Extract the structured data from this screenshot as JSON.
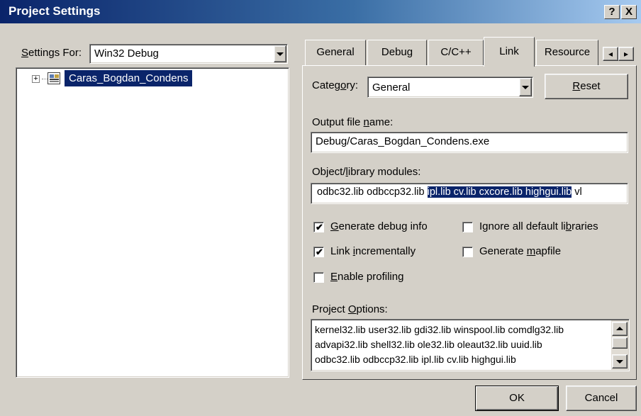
{
  "window": {
    "title": "Project Settings",
    "help_button": "?",
    "close_button": "X"
  },
  "settings_for": {
    "label_prefix": "S",
    "label_rest": "ettings For:",
    "value": "Win32 Debug",
    "tree": [
      {
        "label": "Caras_Bogdan_Condens",
        "expand": "+"
      }
    ]
  },
  "tabs": [
    {
      "label": "General"
    },
    {
      "label": "Debug"
    },
    {
      "label": "C/C++"
    },
    {
      "label": "Link"
    },
    {
      "label": "Resource"
    }
  ],
  "tab_scroll": {
    "left": "◂",
    "right": "▸"
  },
  "category": {
    "label_pre": "Categ",
    "label_u": "o",
    "label_post": "ry:",
    "value": "General"
  },
  "reset_button": {
    "u": "R",
    "rest": "eset"
  },
  "output_file": {
    "label_pre": "Output file ",
    "label_u": "n",
    "label_post": "ame:",
    "value": "Debug/Caras_Bogdan_Condens.exe"
  },
  "object_modules": {
    "label_pre": "Object/",
    "label_u": "l",
    "label_post": "ibrary modules:",
    "value_plain": "odbc32.lib odbccp32.lib ",
    "value_selected": "ipl.lib cv.lib cxcore.lib highgui.lib",
    "value_tail": " vl"
  },
  "options": {
    "generate_debug": {
      "u": "G",
      "rest": "enerate debug info",
      "checked": true
    },
    "ignore_libs": {
      "pre": "Ignore all default li",
      "u": "b",
      "post": "raries",
      "checked": false
    },
    "link_incremental": {
      "pre": "Link ",
      "u": "i",
      "post": "ncrementally",
      "checked": true
    },
    "generate_mapfile": {
      "pre": "Generate ",
      "u": "m",
      "post": "apfile",
      "checked": false
    },
    "enable_profiling": {
      "u": "E",
      "rest": "nable profiling",
      "checked": false
    }
  },
  "project_options": {
    "label_pre": "Project ",
    "label_u": "O",
    "label_post": "ptions:",
    "lines": [
      "kernel32.lib user32.lib gdi32.lib winspool.lib comdlg32.lib",
      "advapi32.lib shell32.lib ole32.lib oleaut32.lib uuid.lib",
      "odbc32.lib odbccp32.lib ipl.lib cv.lib highgui.lib"
    ]
  },
  "footer": {
    "ok": "OK",
    "cancel": "Cancel"
  },
  "checkmark_glyph": "✔"
}
